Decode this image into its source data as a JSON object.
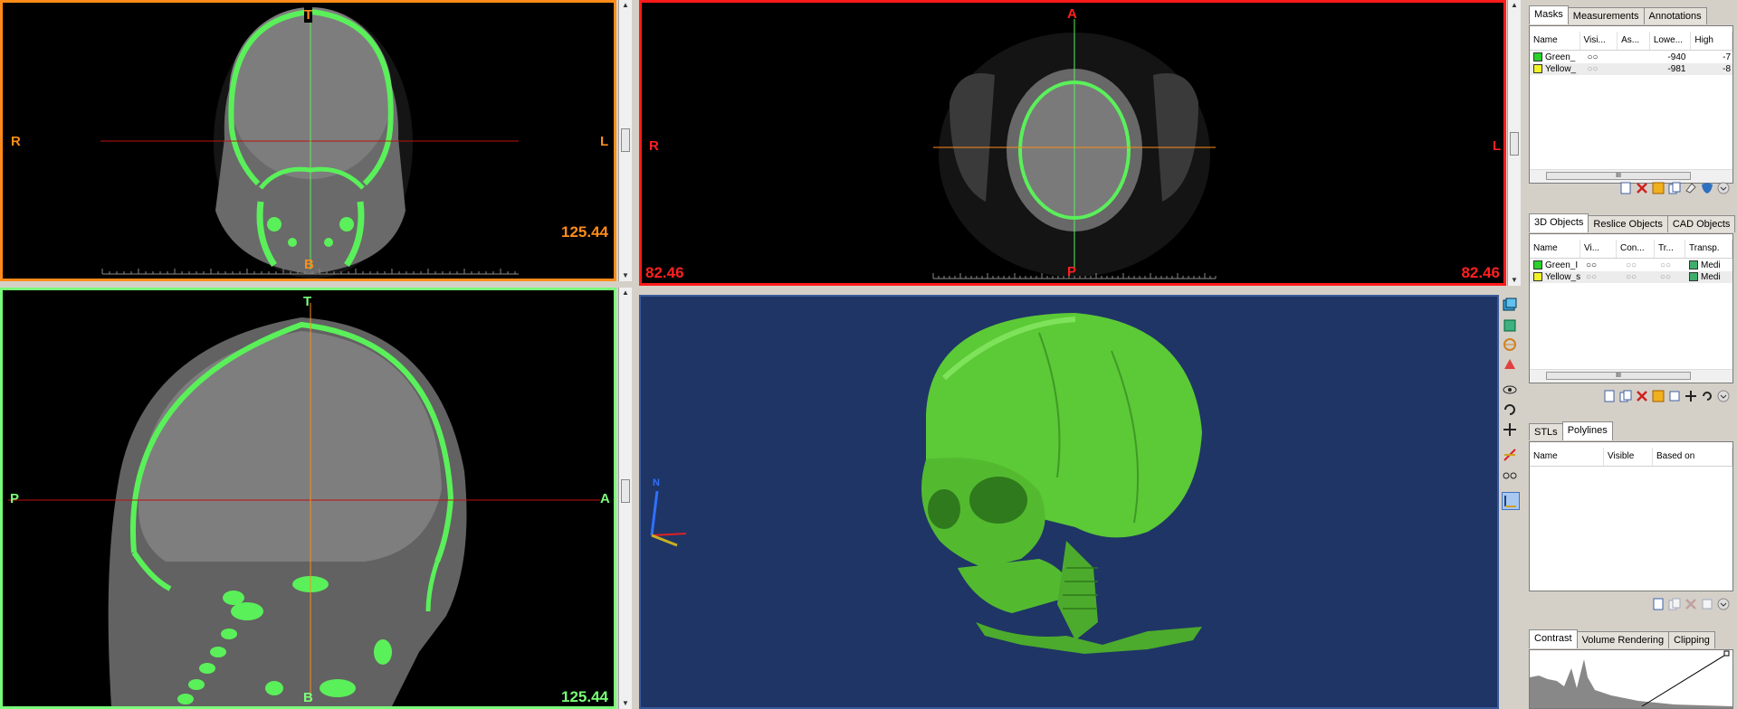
{
  "viewports": {
    "coronal": {
      "top": "T",
      "bottom": "B",
      "left": "R",
      "right": "L",
      "zoom": "125.44",
      "border": "#ff8c1a"
    },
    "axial": {
      "top": "A",
      "bottom": "P",
      "left": "R",
      "right": "L",
      "zoom_left": "82.46",
      "zoom_right": "82.46",
      "border": "#ff1a1a"
    },
    "sagittal": {
      "top": "T",
      "bottom": "B",
      "left": "P",
      "right": "A",
      "zoom": "125.44",
      "border": "#7aff7a"
    },
    "view3d": {
      "background": "#1f3566",
      "axis_label": "N"
    }
  },
  "masks_panel": {
    "tabs": [
      "Masks",
      "Measurements",
      "Annotations"
    ],
    "active_tab": "Masks",
    "columns": [
      "Name",
      "Visi...",
      "As...",
      "Lowe...",
      "High"
    ],
    "rows": [
      {
        "name": "Green_",
        "lower": "-940",
        "high": "-7",
        "color": "#29d129"
      },
      {
        "name": "Yellow_",
        "lower": "-981",
        "high": "-8",
        "color": "#f2f22a"
      }
    ],
    "scroll_thumb": "III"
  },
  "objects_panel": {
    "tabs": [
      "3D Objects",
      "Reslice Objects",
      "CAD Objects"
    ],
    "active_tab": "3D Objects",
    "columns": [
      "Name",
      "Vi...",
      "Con...",
      "Tr...",
      "Transp."
    ],
    "rows": [
      {
        "name": "Green_I",
        "transp": "Medi",
        "color": "#29d129"
      },
      {
        "name": "Yellow_s",
        "transp": "Medi",
        "color": "#f2f22a"
      }
    ],
    "scroll_thumb": "III"
  },
  "polylines_panel": {
    "tabs": [
      "STLs",
      "Polylines"
    ],
    "active_tab": "Polylines",
    "columns": [
      "Name",
      "Visible",
      "Based on"
    ]
  },
  "contrast_panel": {
    "tabs": [
      "Contrast",
      "Volume Rendering",
      "Clipping"
    ],
    "active_tab": "Contrast"
  },
  "colors": {
    "mask_green": "#5af05a",
    "bone_3d": "#5cc936"
  }
}
